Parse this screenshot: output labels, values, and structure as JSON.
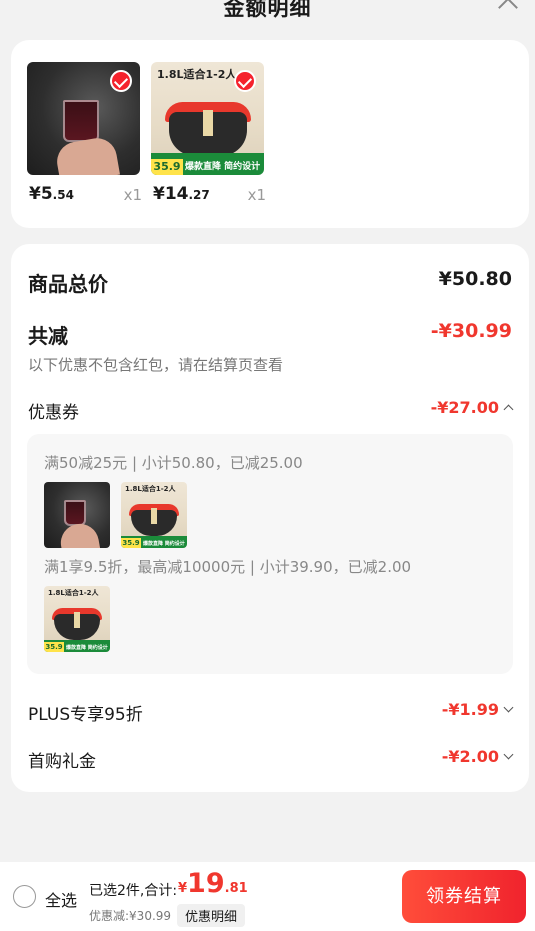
{
  "header": {
    "title": "金额明细"
  },
  "products": [
    {
      "price_int": "¥5",
      "price_dec": ".54",
      "qty": "x1",
      "selected": true
    },
    {
      "price_int": "¥14",
      "price_dec": ".27",
      "qty": "x1",
      "selected": true,
      "img_headline": "1.8L适合1-2人",
      "img_badge": "35.9",
      "img_banner": "爆款直降 简约设计"
    }
  ],
  "summary": {
    "total_label": "商品总价",
    "total_value": "¥50.80",
    "reduce_label": "共减",
    "reduce_value": "-¥30.99",
    "reduce_note": "以下优惠不包含红包，请在结算页查看"
  },
  "coupon": {
    "label": "优惠券",
    "value": "-¥27.00",
    "rule1": "满50减25元 | 小计50.80，已减25.00",
    "rule2": "满1享9.5折，最高减10000元 | 小计39.90，已减2.00"
  },
  "plus": {
    "label": "PLUS专享95折",
    "value": "-¥1.99"
  },
  "first_buy": {
    "label": "首购礼金",
    "value": "-¥2.00"
  },
  "bottom": {
    "select_all": "全选",
    "selected_summary": "已选2件,合计:",
    "total_currency": "¥",
    "total_int": "19",
    "total_dec": ".81",
    "discount": "优惠减:¥30.99",
    "detail_chip": "优惠明细",
    "checkout": "领券结算"
  },
  "colors": {
    "accent": "#f0372e",
    "check": "#f5222d"
  }
}
